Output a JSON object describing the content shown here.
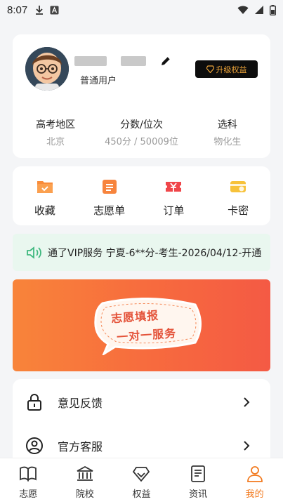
{
  "status_bar": {
    "time": "8:07"
  },
  "profile": {
    "user_type": "普通用户",
    "upgrade_label": "升级权益",
    "stats": [
      {
        "label": "高考地区",
        "value": "北京"
      },
      {
        "label": "分数/位次",
        "value": "450分 / 50009位"
      },
      {
        "label": "选科",
        "value": "物化生"
      }
    ]
  },
  "menu": [
    {
      "label": "收藏",
      "icon": "folder-icon"
    },
    {
      "label": "志愿单",
      "icon": "list-icon"
    },
    {
      "label": "订单",
      "icon": "ticket-icon"
    },
    {
      "label": "卡密",
      "icon": "card-icon"
    }
  ],
  "marquee": {
    "text": "通了VIP服务 宁夏-6**分-考生-2026/04/12-开通"
  },
  "banner": {
    "line1": "志愿填报",
    "line2": "一对一服务"
  },
  "list": [
    {
      "label": "意见反馈",
      "icon": "lock-icon"
    },
    {
      "label": "官方客服",
      "icon": "user-icon"
    }
  ],
  "bottom_nav": [
    {
      "label": "志愿",
      "icon": "book-icon"
    },
    {
      "label": "院校",
      "icon": "school-icon"
    },
    {
      "label": "权益",
      "icon": "diamond-icon"
    },
    {
      "label": "资讯",
      "icon": "news-icon"
    },
    {
      "label": "我的",
      "icon": "profile-icon",
      "active": true
    }
  ],
  "colors": {
    "accent": "#f27a1f",
    "upgrade_bg": "#0d0d0d",
    "upgrade_text": "#f0a63a",
    "marquee_bg": "#e9f7ef"
  }
}
